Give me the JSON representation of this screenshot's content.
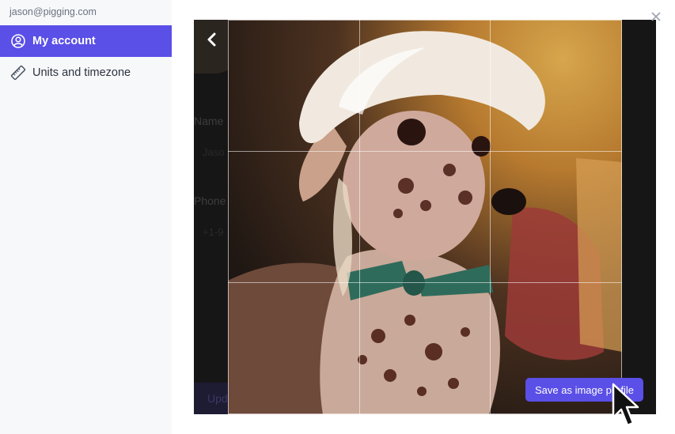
{
  "sidebar": {
    "email": "jason@pigging.com",
    "items": [
      {
        "label": "My account",
        "icon": "user-circle-icon",
        "active": true
      },
      {
        "label": "Units and timezone",
        "icon": "ruler-icon",
        "active": false
      }
    ]
  },
  "background_form": {
    "name_label": "Name",
    "name_value": "Jaso",
    "phone_label": "Phone",
    "phone_value": "+1-9",
    "button_label": "Upd"
  },
  "cropper": {
    "save_label": "Save as image profile"
  },
  "colors": {
    "accent": "#5a4fe6",
    "sidebar_bg": "#f7f8fa",
    "overlay_bg": "#161616"
  }
}
